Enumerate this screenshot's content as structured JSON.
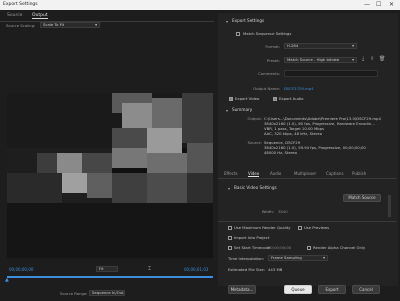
{
  "window": {
    "title": "Export Settings",
    "minimize": "—",
    "maximize": "☐",
    "close": "✕"
  },
  "source_tabs": [
    "Source",
    "Output"
  ],
  "source_scaling": {
    "label": "Source Scaling:",
    "value": "Scale To Fit"
  },
  "timeline": {
    "timecode_in": "00;00;00;00",
    "fit_label": "Fit",
    "timecode_out": "00;00;01;03",
    "source_range_label": "Source Range:",
    "source_range_value": "Sequence In/Out"
  },
  "export_settings": {
    "header": "Export Settings",
    "match_sequence": "Match Sequence Settings",
    "format_label": "Format:",
    "format_value": "H.264",
    "preset_label": "Preset:",
    "preset_value": "Match Source - High bitrate",
    "comments_label": "Comments:",
    "output_name_label": "Output Name:",
    "output_name_value": "DSCF2729.mp4",
    "export_video": "Export Video",
    "export_audio": "Export Audio"
  },
  "summary": {
    "header": "Summary",
    "output_label": "Output:",
    "output_lines": [
      "C:\\Users...\\Documents\\Adobe\\Premiere Pro\\13.0\\DSCF29.mp4",
      "3840x2160 (1.0), 60 fps, Progressive, Hardware Encodin...",
      "VBR, 1 pass, Target 10.00 Mbps",
      "AAC, 320 kbps, 48 kHz, Stereo"
    ],
    "source_label": "Source:",
    "source_lines": [
      "Sequence, DSCF29",
      "3840x2160 (1.0), 59.94 fps, Progressive, 00;00;00;00",
      "48000 Hz, Stereo"
    ]
  },
  "bottom_tabs": [
    "Effects",
    "Video",
    "Audio",
    "Multiplexer",
    "Captions",
    "Publish"
  ],
  "basic_video": {
    "header": "Basic Video Settings",
    "match_source_button": "Match Source",
    "width_label": "Width:",
    "width_value": "3840"
  },
  "options": {
    "max_render_quality": "Use Maximum Render Quality",
    "use_previews": "Use Previews",
    "import_into_project": "Import Into Project",
    "set_start_timecode": "Set Start Timecode",
    "start_timecode_value": "00;00;00;00",
    "render_alpha": "Render Alpha Channel Only",
    "time_interp_label": "Time Interpolation:",
    "time_interp_value": "Frame Sampling",
    "file_size_label": "Estimated File Size:",
    "file_size_value": "443 MB"
  },
  "buttons": {
    "metadata": "Metadata...",
    "queue": "Queue",
    "export": "Export",
    "cancel": "Cancel"
  },
  "colors": {
    "accent": "#3d8fd9",
    "background": "#1d1d1d",
    "panel": "#232323"
  }
}
